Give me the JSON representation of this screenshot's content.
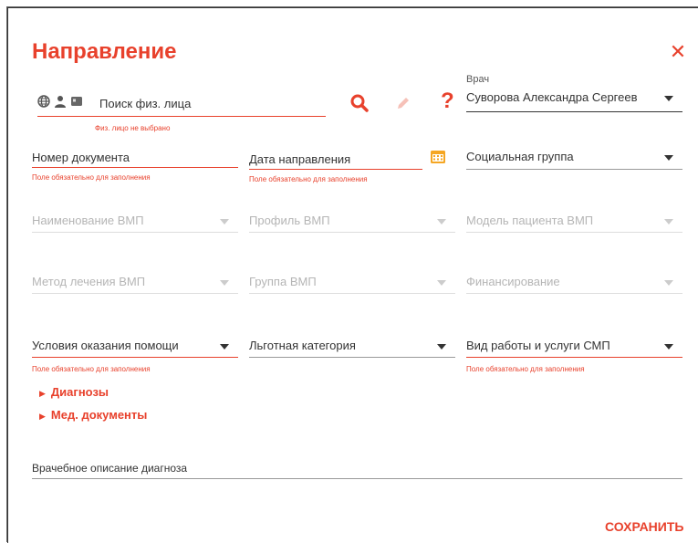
{
  "dialog": {
    "title": "Направление",
    "save_label": "СОХРАНИТЬ"
  },
  "search": {
    "placeholder": "Поиск физ. лица",
    "error": "Физ. лицо не выбрано"
  },
  "doctor": {
    "label": "Врач",
    "value": "Суворова Александра Сергеев"
  },
  "fields": {
    "doc_number": {
      "label": "Номер документа",
      "error": "Поле обязательно для заполнения"
    },
    "ref_date": {
      "label": "Дата направления",
      "error": "Поле обязательно для заполнения"
    },
    "social_group": {
      "label": "Социальная группа"
    },
    "vmp_name": {
      "label": "Наименование ВМП"
    },
    "vmp_profile": {
      "label": "Профиль ВМП"
    },
    "vmp_patient_model": {
      "label": "Модель пациента ВМП"
    },
    "vmp_method": {
      "label": "Метод лечения ВМП"
    },
    "vmp_group": {
      "label": "Группа ВМП"
    },
    "financing": {
      "label": "Финансирование"
    },
    "care_conditions": {
      "label": "Условия оказания помощи",
      "error": "Поле обязательно для заполнения"
    },
    "benefit_category": {
      "label": "Льготная категория"
    },
    "smp_services": {
      "label": "Вид работы и услуги СМП",
      "error": "Поле обязательно для заполнения"
    },
    "diagnosis_desc": {
      "label": "Врачебное описание диагноза"
    }
  },
  "sections": {
    "diagnoses": "Диагнозы",
    "med_docs": "Мед. документы"
  },
  "colors": {
    "accent": "#e8412c",
    "warning": "#f5a623"
  }
}
